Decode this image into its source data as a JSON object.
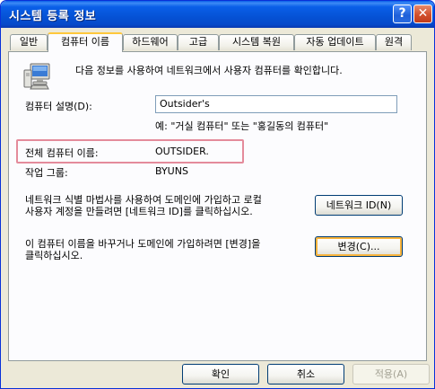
{
  "window": {
    "title": "시스템 등록 정보",
    "help_label": "?",
    "close_label": "✕"
  },
  "tabs": [
    {
      "label": "일반"
    },
    {
      "label": "컴퓨터 이름"
    },
    {
      "label": "하드웨어"
    },
    {
      "label": "고급"
    },
    {
      "label": "시스템 복원"
    },
    {
      "label": "자동 업데이트"
    },
    {
      "label": "원격"
    }
  ],
  "computer_name_tab": {
    "intro": "다음 정보를 사용하여 네트워크에서 사용자 컴퓨터를 확인합니다.",
    "description_label": "컴퓨터 설명(D):",
    "description_value": "Outsider's",
    "description_example": "예: \"거실 컴퓨터\" 또는 \"홍길동의 컴퓨터\"",
    "full_name_label": "전체 컴퓨터 이름:",
    "full_name_value": "OUTSIDER.",
    "workgroup_label": "작업 그룹:",
    "workgroup_value": "BYUNS",
    "network_id_text_line1": "네트워크 식별 마법사를 사용하여 도메인에 가입하고 로컬",
    "network_id_text_line2": "사용자 계정을 만들려면 [네트워크 ID]를 클릭하십시오.",
    "network_id_button": "네트워크 ID(N)",
    "change_text_line1": "이 컴퓨터 이름을 바꾸거나 도메인에 가입하려면 [변경]을",
    "change_text_line2": "클릭하십시오.",
    "change_button": "변경(C)..."
  },
  "footer": {
    "ok_button": "확인",
    "cancel_button": "취소",
    "apply_button": "적용(A)"
  },
  "colors": {
    "titlebar": "#0a5fe8",
    "dialog_bg": "#ece9d8",
    "highlight_border": "#e48b9b"
  }
}
